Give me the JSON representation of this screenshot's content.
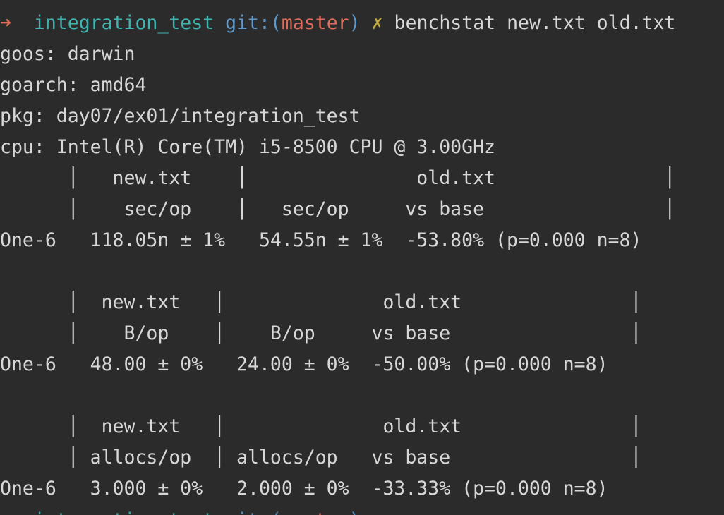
{
  "prompt": {
    "arrow": "➜",
    "directory": "integration_test",
    "git_prefix": "git:(",
    "branch": "master",
    "git_suffix": ")",
    "dirty_mark": "✗",
    "command": "benchstat new.txt old.txt"
  },
  "env": {
    "goos": "goos: darwin",
    "goarch": "goarch: amd64",
    "pkg": "pkg: day07/ex01/integration_test",
    "cpu": "cpu: Intel(R) Core(TM) i5-8500 CPU @ 3.00GHz"
  },
  "tables": [
    {
      "header1": "      │   new.txt    │               old.txt               │",
      "header2": "      │    sec/op    │   sec/op     vs base                │",
      "row": "One-6   118.05n ± 1%   54.55n ± 1%  -53.80% (p=0.000 n=8)"
    },
    {
      "header1": "      │  new.txt   │              old.txt               │",
      "header2": "      │    B/op    │    B/op     vs base                │",
      "row": "One-6   48.00 ± 0%   24.00 ± 0%  -50.00% (p=0.000 n=8)"
    },
    {
      "header1": "      │  new.txt   │              old.txt               │",
      "header2": "      │ allocs/op  │ allocs/op   vs base                │",
      "row": "One-6   3.000 ± 0%   2.000 ± 0%  -33.33% (p=0.000 n=8)"
    }
  ]
}
